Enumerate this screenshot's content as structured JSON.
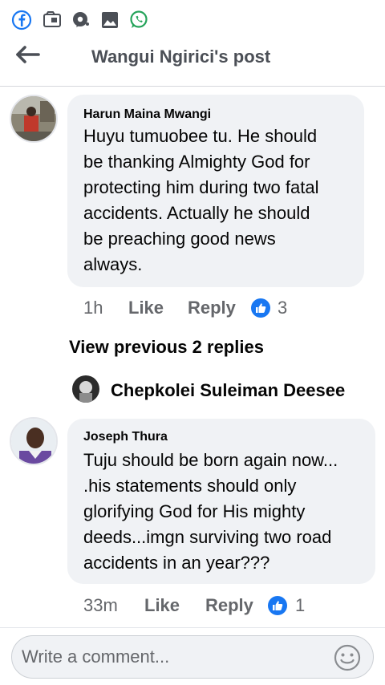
{
  "header": {
    "title": "Wangui Ngirici's post"
  },
  "comments": [
    {
      "author": "Harun Maina Mwangi",
      "text": "Huyu tumuobee tu. He should\nbe thanking Almighty God for\nprotecting him during two fatal\naccidents. Actually he should\nbe preaching good news\nalways.",
      "time": "1h",
      "like_label": "Like",
      "reply_label": "Reply",
      "reactions": "3"
    },
    {
      "author": "Joseph Thura",
      "text": "Tuju should be born again now...\n.his statements should only\nglorifying God for  His mighty\ndeeds...imgn surviving two road\naccidents in an year???",
      "time": "33m",
      "like_label": "Like",
      "reply_label": "Reply",
      "reactions": "1"
    }
  ],
  "replies": {
    "view_previous": "View previous 2 replies",
    "latest_replier": "Chepkolei Suleiman Deesee"
  },
  "composer": {
    "placeholder": "Write a comment..."
  },
  "colors": {
    "accent": "#1877f2",
    "bubble": "#f0f2f5",
    "meta": "#65676b"
  },
  "icons": [
    "facebook-icon",
    "gallery-icon",
    "messenger-icon",
    "image-icon",
    "whatsapp-icon",
    "back-arrow-icon",
    "like-reaction-icon",
    "emoji-icon"
  ]
}
